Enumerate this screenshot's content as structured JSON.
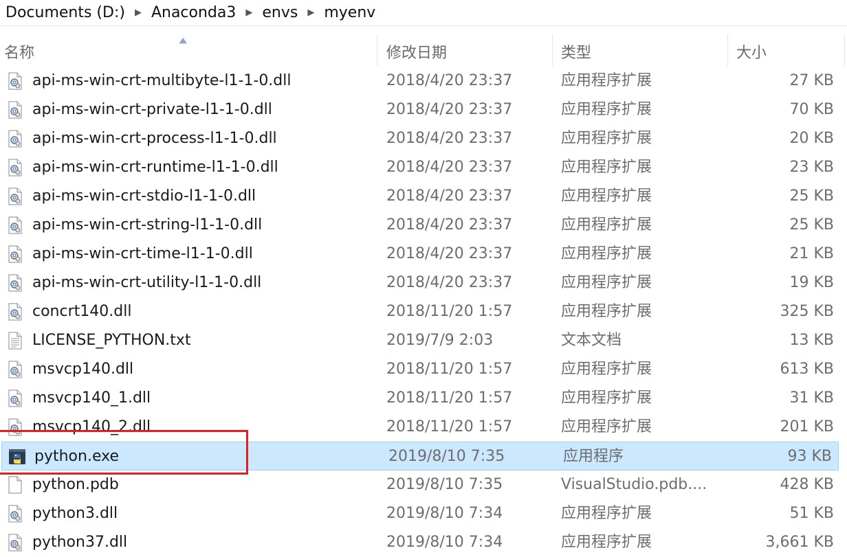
{
  "breadcrumb": {
    "items": [
      "Documents (D:)",
      "Anaconda3",
      "envs",
      "myenv"
    ],
    "separator": "▶"
  },
  "columns": {
    "name": "名称",
    "date": "修改日期",
    "type": "类型",
    "size": "大小"
  },
  "files": [
    {
      "name": "api-ms-win-crt-multibyte-l1-1-0.dll",
      "date": "2018/4/20 23:37",
      "type": "应用程序扩展",
      "size": "27 KB",
      "icon": "dll-icon"
    },
    {
      "name": "api-ms-win-crt-private-l1-1-0.dll",
      "date": "2018/4/20 23:37",
      "type": "应用程序扩展",
      "size": "70 KB",
      "icon": "dll-icon"
    },
    {
      "name": "api-ms-win-crt-process-l1-1-0.dll",
      "date": "2018/4/20 23:37",
      "type": "应用程序扩展",
      "size": "20 KB",
      "icon": "dll-icon"
    },
    {
      "name": "api-ms-win-crt-runtime-l1-1-0.dll",
      "date": "2018/4/20 23:37",
      "type": "应用程序扩展",
      "size": "23 KB",
      "icon": "dll-icon"
    },
    {
      "name": "api-ms-win-crt-stdio-l1-1-0.dll",
      "date": "2018/4/20 23:37",
      "type": "应用程序扩展",
      "size": "25 KB",
      "icon": "dll-icon"
    },
    {
      "name": "api-ms-win-crt-string-l1-1-0.dll",
      "date": "2018/4/20 23:37",
      "type": "应用程序扩展",
      "size": "25 KB",
      "icon": "dll-icon"
    },
    {
      "name": "api-ms-win-crt-time-l1-1-0.dll",
      "date": "2018/4/20 23:37",
      "type": "应用程序扩展",
      "size": "21 KB",
      "icon": "dll-icon"
    },
    {
      "name": "api-ms-win-crt-utility-l1-1-0.dll",
      "date": "2018/4/20 23:37",
      "type": "应用程序扩展",
      "size": "19 KB",
      "icon": "dll-icon"
    },
    {
      "name": "concrt140.dll",
      "date": "2018/11/20 1:57",
      "type": "应用程序扩展",
      "size": "325 KB",
      "icon": "dll-icon"
    },
    {
      "name": "LICENSE_PYTHON.txt",
      "date": "2019/7/9 2:03",
      "type": "文本文档",
      "size": "13 KB",
      "icon": "text-file-icon"
    },
    {
      "name": "msvcp140.dll",
      "date": "2018/11/20 1:57",
      "type": "应用程序扩展",
      "size": "613 KB",
      "icon": "dll-icon"
    },
    {
      "name": "msvcp140_1.dll",
      "date": "2018/11/20 1:57",
      "type": "应用程序扩展",
      "size": "31 KB",
      "icon": "dll-icon"
    },
    {
      "name": "msvcp140_2.dll",
      "date": "2018/11/20 1:57",
      "type": "应用程序扩展",
      "size": "201 KB",
      "icon": "dll-icon"
    },
    {
      "name": "python.exe",
      "date": "2019/8/10 7:35",
      "type": "应用程序",
      "size": "93 KB",
      "icon": "python-exe-icon",
      "selected": true
    },
    {
      "name": "python.pdb",
      "date": "2019/8/10 7:35",
      "type": "VisualStudio.pdb....",
      "size": "428 KB",
      "icon": "blank-file-icon"
    },
    {
      "name": "python3.dll",
      "date": "2019/8/10 7:34",
      "type": "应用程序扩展",
      "size": "51 KB",
      "icon": "dll-icon"
    },
    {
      "name": "python37.dll",
      "date": "2019/8/10 7:34",
      "type": "应用程序扩展",
      "size": "3,661 KB",
      "icon": "dll-icon"
    }
  ],
  "colors": {
    "selection_bg": "#cce8ff",
    "selection_border": "#99d1ff",
    "highlight_box": "#e02020"
  }
}
